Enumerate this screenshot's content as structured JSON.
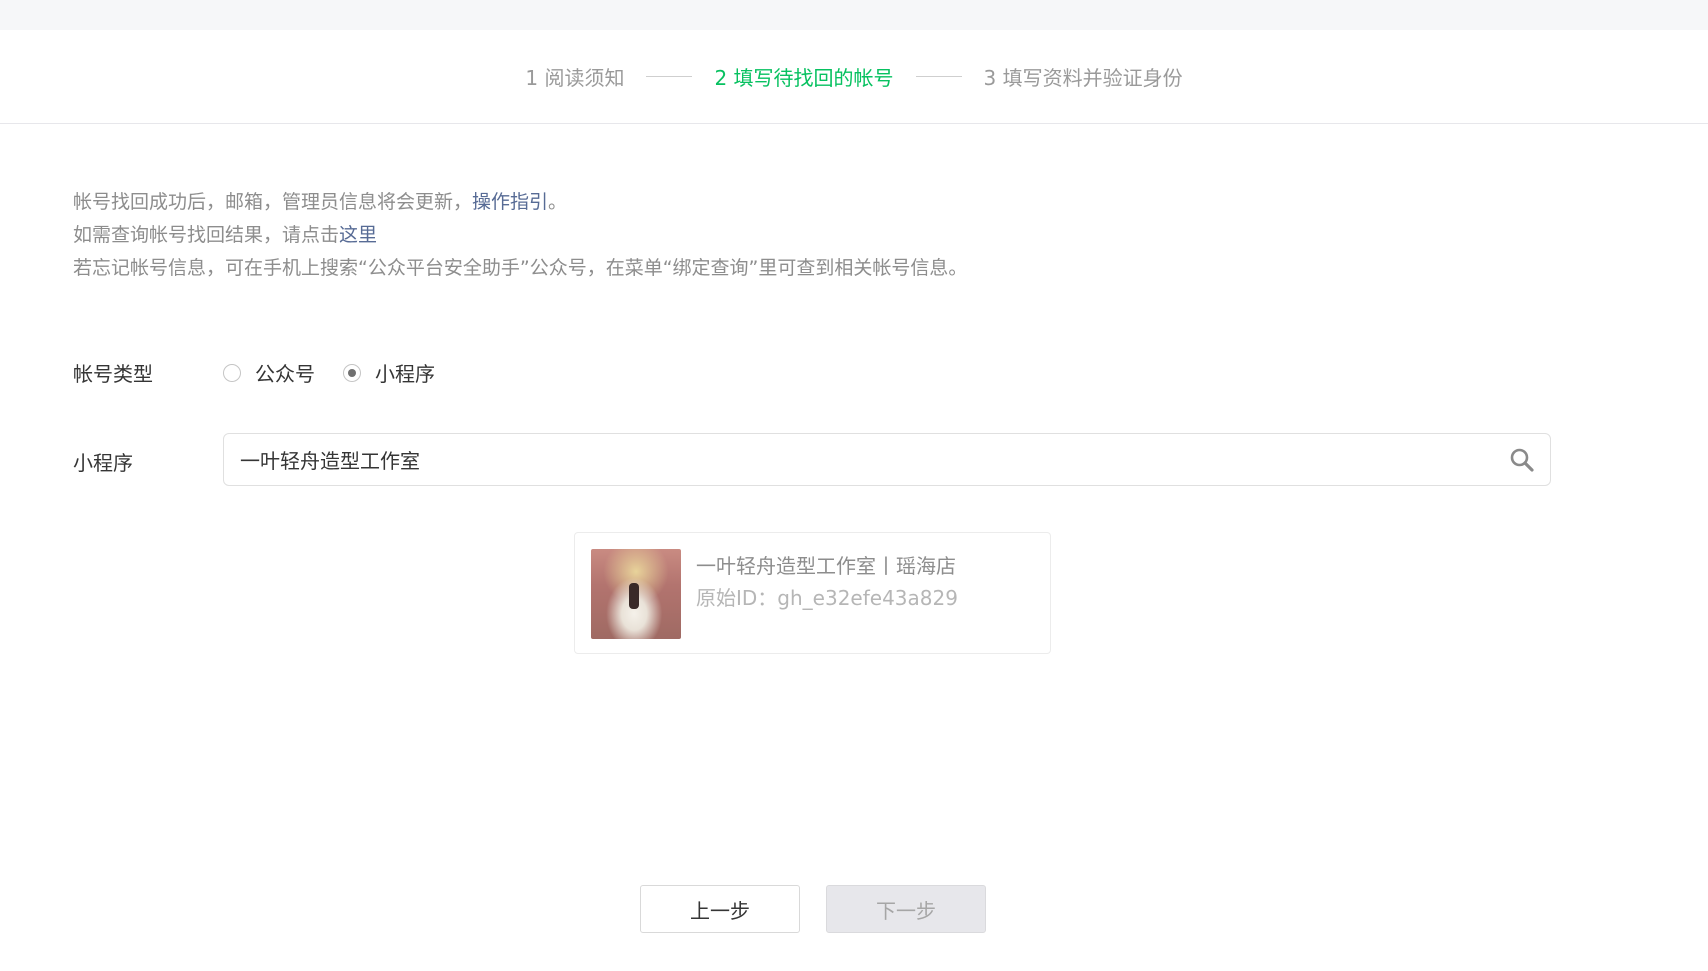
{
  "steps": [
    {
      "label": "1 阅读须知"
    },
    {
      "label": "2 填写待找回的帐号"
    },
    {
      "label": "3 填写资料并验证身份"
    }
  ],
  "notice": {
    "line1_text": "帐号找回成功后，邮箱，管理员信息将会更新，",
    "line1_link": "操作指引",
    "line1_end": "。",
    "line2_text": "如需查询帐号找回结果，请点击",
    "line2_link": "这里",
    "line3_text": "若忘记帐号信息，可在手机上搜索“公众平台安全助手”公众号，在菜单“绑定查询”里可查到相关帐号信息。"
  },
  "account_type": {
    "label": "帐号类型",
    "options": [
      {
        "label": "公众号",
        "checked": false
      },
      {
        "label": "小程序",
        "checked": true
      }
    ]
  },
  "mini_program": {
    "label": "小程序",
    "search_value": "一叶轻舟造型工作室",
    "search_icon": "search-icon"
  },
  "result": {
    "name": "一叶轻舟造型工作室丨瑶海店",
    "id_text": "原始ID：gh_e32efe43a829"
  },
  "buttons": {
    "prev": "上一步",
    "next": "下一步"
  },
  "colors": {
    "accent_green": "#07c160",
    "link_blue": "#576b95"
  }
}
